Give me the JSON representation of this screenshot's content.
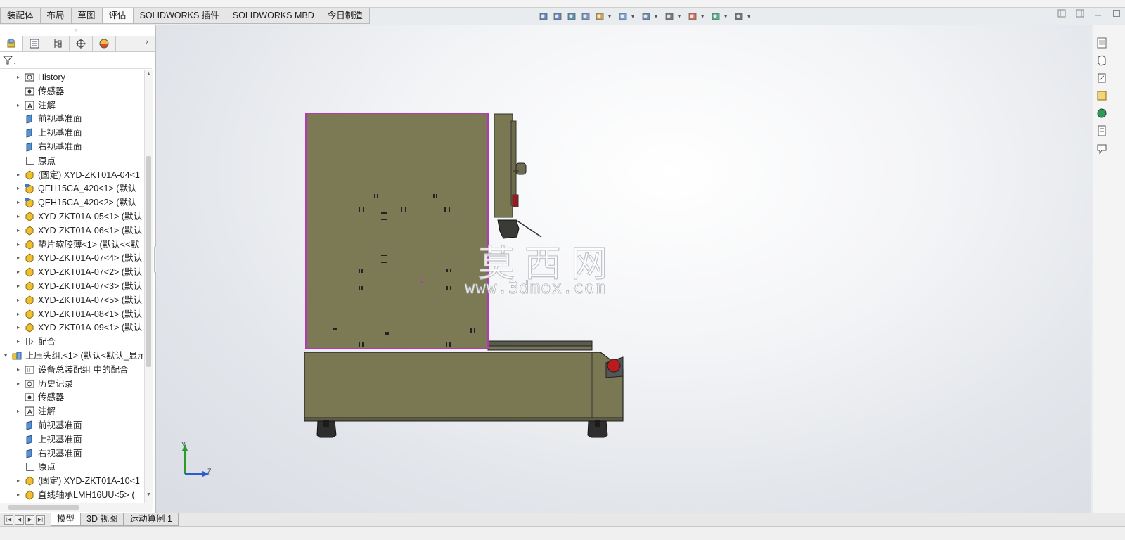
{
  "command_tabs": [
    {
      "label": "装配体",
      "active": false
    },
    {
      "label": "布局",
      "active": false
    },
    {
      "label": "草图",
      "active": false
    },
    {
      "label": "评估",
      "active": true
    },
    {
      "label": "SOLIDWORKS 插件",
      "active": false
    },
    {
      "label": "SOLIDWORKS MBD",
      "active": false
    },
    {
      "label": "今日制造",
      "active": false
    }
  ],
  "view_toolbar_icons": [
    "zoom-to-fit-icon",
    "zoom-area-icon",
    "previous-view-icon",
    "section-view-icon",
    "dynamic-annotation-icon",
    "view-orientation-icon",
    "display-style-icon",
    "hide-show-icon",
    "edit-appearance-icon",
    "apply-scene-icon",
    "view-settings-icon"
  ],
  "feature_tree": [
    {
      "label": "History",
      "icon": "history-icon",
      "indent": 1,
      "expander": true
    },
    {
      "label": "传感器",
      "icon": "sensor-icon",
      "indent": 1,
      "expander": false
    },
    {
      "label": "注解",
      "icon": "annotation-icon",
      "indent": 1,
      "expander": true
    },
    {
      "label": "前视基准面",
      "icon": "plane-icon",
      "indent": 1,
      "expander": false
    },
    {
      "label": "上视基准面",
      "icon": "plane-icon",
      "indent": 1,
      "expander": false
    },
    {
      "label": "右视基准面",
      "icon": "plane-icon",
      "indent": 1,
      "expander": false
    },
    {
      "label": "原点",
      "icon": "origin-icon",
      "indent": 1,
      "expander": false
    },
    {
      "label": "(固定) XYD-ZKT01A-04<1",
      "icon": "part-icon",
      "indent": 1,
      "expander": true
    },
    {
      "label": "QEH15CA_420<1> (默认",
      "icon": "subassembly-part-icon",
      "indent": 1,
      "expander": true
    },
    {
      "label": "QEH15CA_420<2> (默认",
      "icon": "subassembly-part-icon",
      "indent": 1,
      "expander": true
    },
    {
      "label": "XYD-ZKT01A-05<1> (默认",
      "icon": "part-icon",
      "indent": 1,
      "expander": true
    },
    {
      "label": "XYD-ZKT01A-06<1> (默认",
      "icon": "part-icon",
      "indent": 1,
      "expander": true
    },
    {
      "label": "垫片软胶薄<1> (默认<<默",
      "icon": "part-icon",
      "indent": 1,
      "expander": true
    },
    {
      "label": "XYD-ZKT01A-07<4> (默认",
      "icon": "part-icon",
      "indent": 1,
      "expander": true
    },
    {
      "label": "XYD-ZKT01A-07<2> (默认",
      "icon": "part-icon",
      "indent": 1,
      "expander": true
    },
    {
      "label": "XYD-ZKT01A-07<3> (默认",
      "icon": "part-icon",
      "indent": 1,
      "expander": true
    },
    {
      "label": "XYD-ZKT01A-07<5> (默认",
      "icon": "part-icon",
      "indent": 1,
      "expander": true
    },
    {
      "label": "XYD-ZKT01A-08<1> (默认",
      "icon": "part-icon",
      "indent": 1,
      "expander": true
    },
    {
      "label": "XYD-ZKT01A-09<1> (默认",
      "icon": "part-icon",
      "indent": 1,
      "expander": true
    },
    {
      "label": "配合",
      "icon": "mates-icon",
      "indent": 1,
      "expander": true
    },
    {
      "label": "上压头组.<1> (默认<默认_显示",
      "icon": "assembly-icon",
      "indent": 0,
      "expander": true
    },
    {
      "label": "设备总装配组 中的配合",
      "icon": "mates-folder-icon",
      "indent": 1,
      "expander": true
    },
    {
      "label": "历史记录",
      "icon": "history-icon",
      "indent": 1,
      "expander": true
    },
    {
      "label": "传感器",
      "icon": "sensor-icon",
      "indent": 1,
      "expander": false
    },
    {
      "label": "注解",
      "icon": "annotation-icon",
      "indent": 1,
      "expander": true
    },
    {
      "label": "前视基准面",
      "icon": "plane-icon",
      "indent": 1,
      "expander": false
    },
    {
      "label": "上视基准面",
      "icon": "plane-icon",
      "indent": 1,
      "expander": false
    },
    {
      "label": "右视基准面",
      "icon": "plane-icon",
      "indent": 1,
      "expander": false
    },
    {
      "label": "原点",
      "icon": "origin-icon",
      "indent": 1,
      "expander": false
    },
    {
      "label": "(固定) XYD-ZKT01A-10<1",
      "icon": "part-icon",
      "indent": 1,
      "expander": true
    },
    {
      "label": "直线轴承LMH16UU<5> (",
      "icon": "part-icon",
      "indent": 1,
      "expander": true
    }
  ],
  "watermark": {
    "cn": "莫西网",
    "url": "www.3dmox.com"
  },
  "triad": {
    "y_label": "Y",
    "z_label": "Z"
  },
  "bottom_tabs": [
    {
      "label": "模型",
      "active": true
    },
    {
      "label": "3D 视图",
      "active": false
    },
    {
      "label": "运动算例 1",
      "active": false
    }
  ],
  "colors": {
    "model_body": "#7c7a55",
    "selection_outline": "#b23bb5",
    "accent_tab": "#fafafa"
  }
}
